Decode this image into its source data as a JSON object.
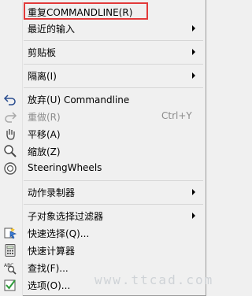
{
  "menu": {
    "items": [
      {
        "label": "重复COMMANDLINE(R)"
      },
      {
        "label": "最近的输入"
      },
      {
        "label": "剪贴板"
      },
      {
        "label": "隔离(I)"
      },
      {
        "label": "放弃(U) Commandline"
      },
      {
        "label": "重做(R)",
        "shortcut": "Ctrl+Y"
      },
      {
        "label": "平移(A)"
      },
      {
        "label": "缩放(Z)"
      },
      {
        "label": "SteeringWheels"
      },
      {
        "label": "动作录制器"
      },
      {
        "label": "子对象选择过滤器"
      },
      {
        "label": "快速选择(Q)..."
      },
      {
        "label": "快速计算器"
      },
      {
        "label": "查找(F)..."
      },
      {
        "label": "选项(O)..."
      }
    ],
    "icons": [
      "undo-icon",
      "redo-icon",
      "pan-icon",
      "zoom-icon",
      "steering-wheels-icon",
      "quick-select-icon",
      "calculator-icon",
      "find-icon",
      "options-icon"
    ],
    "highlight_color": "#e23a3a"
  },
  "watermark": "www.ttcad.com"
}
